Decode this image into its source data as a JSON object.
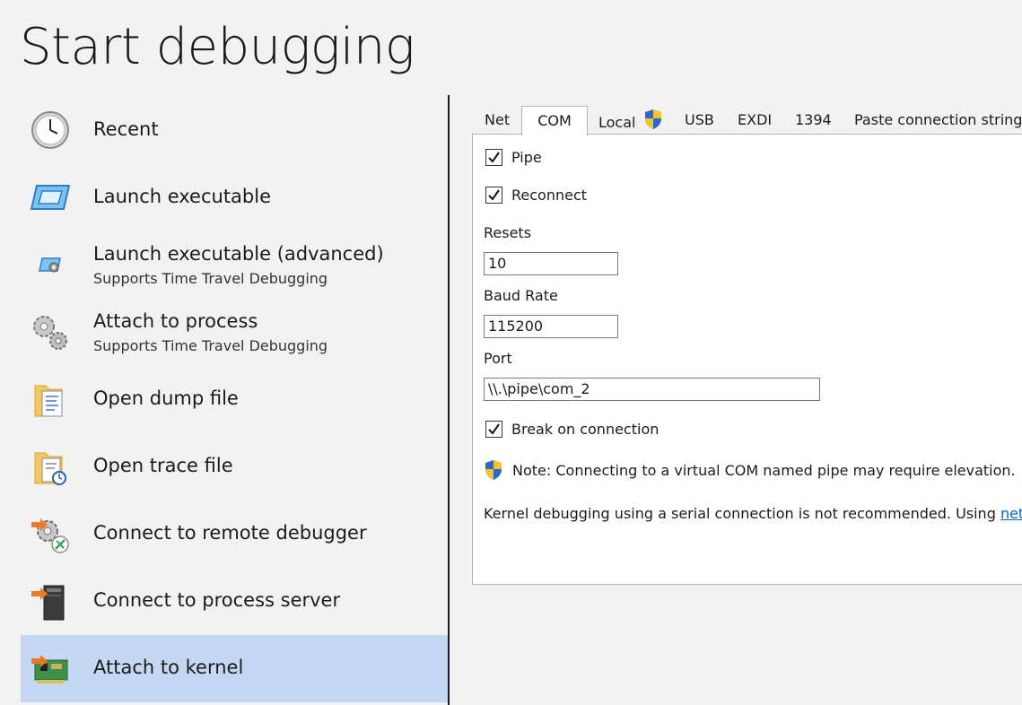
{
  "page": {
    "title": "Start debugging"
  },
  "sidebar": {
    "items": [
      {
        "label": "Recent",
        "icon": "clock-icon"
      },
      {
        "label": "Launch executable",
        "icon": "executable-icon"
      },
      {
        "label": "Launch executable (advanced)",
        "sublabel": "Supports Time Travel Debugging",
        "icon": "executable-advanced-icon"
      },
      {
        "label": "Attach to process",
        "sublabel": "Supports Time Travel Debugging",
        "icon": "gears-icon"
      },
      {
        "label": "Open dump file",
        "icon": "dump-file-icon"
      },
      {
        "label": "Open trace file",
        "icon": "trace-file-icon"
      },
      {
        "label": "Connect to remote debugger",
        "icon": "remote-debugger-icon"
      },
      {
        "label": "Connect to process server",
        "icon": "process-server-icon"
      },
      {
        "label": "Attach to kernel",
        "icon": "kernel-board-icon",
        "selected": true
      }
    ]
  },
  "tabs": {
    "items": [
      "Net",
      "COM",
      "Local",
      "USB",
      "EXDI",
      "1394",
      "Paste connection string"
    ],
    "active": "COM"
  },
  "com": {
    "pipe": {
      "label": "Pipe",
      "checked": true
    },
    "reconnect": {
      "label": "Reconnect",
      "checked": true
    },
    "resets": {
      "label": "Resets",
      "value": "10"
    },
    "baud": {
      "label": "Baud Rate",
      "value": "115200"
    },
    "port": {
      "label": "Port",
      "value": "\\\\.\\pipe\\com_2"
    },
    "break_on_connection": {
      "label": "Break on connection",
      "checked": true
    },
    "note": "Note: Connecting to a virtual COM named pipe may require elevation.",
    "info_text": "Kernel debugging using a serial connection is not recommended. Using ",
    "info_link": "netw"
  },
  "colors": {
    "selected_bg": "#c5d7f2",
    "accent": "#0066cc",
    "background": "#f2f2f2"
  }
}
